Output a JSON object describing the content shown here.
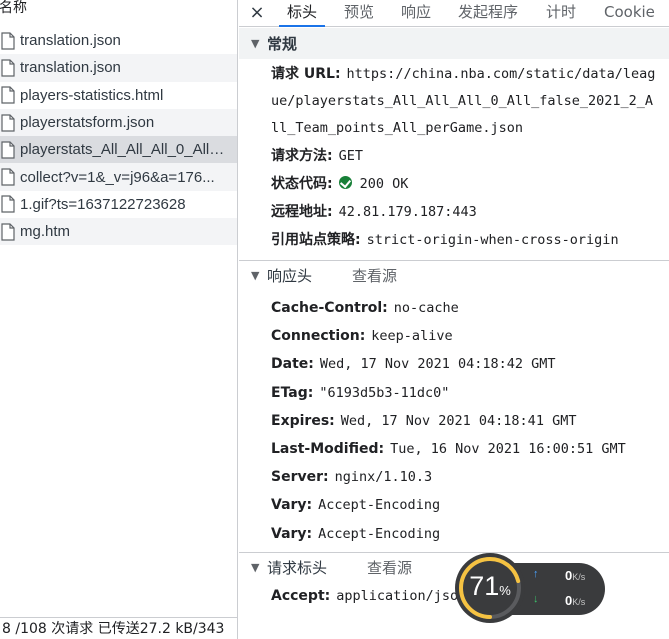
{
  "list": {
    "header": "名称",
    "items": [
      {
        "name": "translation.json"
      },
      {
        "name": "translation.json"
      },
      {
        "name": "players-statistics.html"
      },
      {
        "name": "playerstatsform.json"
      },
      {
        "name": "playerstats_All_All_All_0_All_f..."
      },
      {
        "name": "collect?v=1&_v=j96&a=176..."
      },
      {
        "name": "1.gif?ts=1637122723628"
      },
      {
        "name": "mg.htm"
      }
    ],
    "status": "8 /108 次请求  已传送27.2 kB/343"
  },
  "tabs": {
    "close_icon": "×",
    "items": [
      "标头",
      "预览",
      "响应",
      "发起程序",
      "计时",
      "Cookie"
    ],
    "active": "标头"
  },
  "general": {
    "title": "常规",
    "url_label": "请求 URL:",
    "url_value": "https://china.nba.com/static/data/league/playerstats_All_All_All_0_All_false_2021_2_All_Team_points_All_perGame.json",
    "method_label": "请求方法:",
    "method_value": "GET",
    "status_label": "状态代码:",
    "status_value": "200 OK",
    "remote_label": "远程地址:",
    "remote_value": "42.81.179.187:443",
    "referrer_label": "引用站点策略:",
    "referrer_value": "strict-origin-when-cross-origin"
  },
  "response_headers": {
    "title": "响应头",
    "view_source": "查看源",
    "items": [
      {
        "key": "Cache-Control:",
        "value": "no-cache"
      },
      {
        "key": "Connection:",
        "value": "keep-alive"
      },
      {
        "key": "Date:",
        "value": "Wed, 17 Nov 2021 04:18:42 GMT"
      },
      {
        "key": "ETag:",
        "value": "\"6193d5b3-11dc0\""
      },
      {
        "key": "Expires:",
        "value": "Wed, 17 Nov 2021 04:18:41 GMT"
      },
      {
        "key": "Last-Modified:",
        "value": "Tue, 16 Nov 2021 16:00:51 GMT"
      },
      {
        "key": "Server:",
        "value": "nginx/1.10.3"
      },
      {
        "key": "Vary:",
        "value": "Accept-Encoding"
      },
      {
        "key": "Vary:",
        "value": "Accept-Encoding"
      }
    ]
  },
  "request_headers": {
    "title": "请求标头",
    "view_source": "查看源",
    "items": [
      {
        "key": "Accept:",
        "value": "application/json, text/plain, */*"
      }
    ]
  },
  "speed_widget": {
    "percent": "71",
    "percent_sign": "%",
    "up_arrow": "↑",
    "down_arrow": "↓",
    "up_value": "0",
    "down_value": "0",
    "unit": "K/s",
    "ring_fraction": 0.71,
    "ring_color": "#f5c242"
  },
  "colors": {
    "accent": "#1a73e8",
    "status_ok": "#188038"
  }
}
